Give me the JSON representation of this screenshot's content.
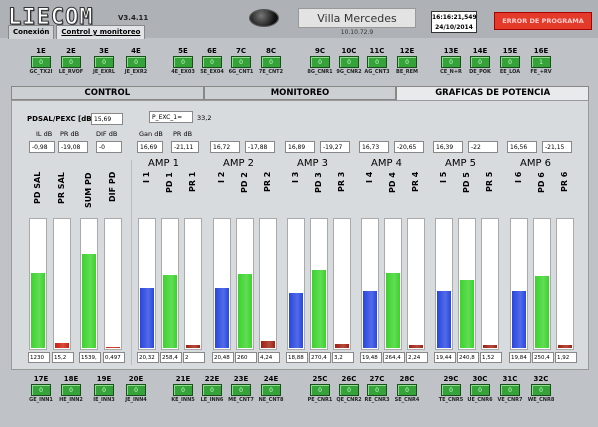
{
  "header": {
    "logo": "LIECOM",
    "version": "V3.4.11",
    "site_name": "Villa Mercedes",
    "ip": "10.10.72.9",
    "time": "16:16:21,549",
    "date": "24/10/2014",
    "alarm_label": "ERROR DE PROGRAMA",
    "tabs": [
      "Conexión",
      "Control y monitoreo"
    ]
  },
  "top_leds": [
    {
      "code": "1E",
      "val": "0",
      "label": "GC_TX2I"
    },
    {
      "code": "2E",
      "val": "0",
      "label": "LE_RVOF"
    },
    {
      "code": "3E",
      "val": "0",
      "label": "JE_EXRL"
    },
    {
      "code": "4E",
      "val": "0",
      "label": "JE_EXR2"
    },
    {
      "code": "5E",
      "val": "0",
      "label": "4E_EX03"
    },
    {
      "code": "6E",
      "val": "0",
      "label": "5E_EX04"
    },
    {
      "code": "7C",
      "val": "0",
      "label": "6G_CNT1"
    },
    {
      "code": "8C",
      "val": "0",
      "label": "7E_CNT2"
    },
    {
      "code": "9C",
      "val": "0",
      "label": "8G_CNR1"
    },
    {
      "code": "10C",
      "val": "0",
      "label": "9G_CNR2"
    },
    {
      "code": "11C",
      "val": "0",
      "label": "AG_CNT3"
    },
    {
      "code": "12E",
      "val": "0",
      "label": "BE_REM"
    },
    {
      "code": "13E",
      "val": "0",
      "label": "CE_N+R"
    },
    {
      "code": "14E",
      "val": "0",
      "label": "DE_POK"
    },
    {
      "code": "15E",
      "val": "0",
      "label": "EE_LOA"
    },
    {
      "code": "16E",
      "val": "1",
      "label": "FE_+RV"
    }
  ],
  "bottom_leds": [
    {
      "code": "17E",
      "val": "0",
      "label": "GE_INN1"
    },
    {
      "code": "18E",
      "val": "0",
      "label": "HE_INN2"
    },
    {
      "code": "19E",
      "val": "0",
      "label": "IE_INN3"
    },
    {
      "code": "20E",
      "val": "0",
      "label": "JE_INN4"
    },
    {
      "code": "21E",
      "val": "0",
      "label": "KE_INN5"
    },
    {
      "code": "22E",
      "val": "0",
      "label": "LE_INN6"
    },
    {
      "code": "23E",
      "val": "0",
      "label": "ME_CNT7"
    },
    {
      "code": "24E",
      "val": "0",
      "label": "NE_CNT8"
    },
    {
      "code": "25C",
      "val": "0",
      "label": "PE_CNR1"
    },
    {
      "code": "26C",
      "val": "0",
      "label": "QE_CNR2"
    },
    {
      "code": "27C",
      "val": "0",
      "label": "RE_CNR3"
    },
    {
      "code": "28C",
      "val": "0",
      "label": "SE_CNR4"
    },
    {
      "code": "29C",
      "val": "0",
      "label": "TE_CNR5"
    },
    {
      "code": "30C",
      "val": "0",
      "label": "UE_CNR6"
    },
    {
      "code": "31C",
      "val": "0",
      "label": "VE_CNR7"
    },
    {
      "code": "32C",
      "val": "0",
      "label": "WE_CNR8"
    }
  ],
  "main_tabs": [
    "CONTROL",
    "MONITOREO",
    "GRAFICAS DE POTENCIA"
  ],
  "summary": {
    "pdsal_label": "PDSAL/PEXC [dB]",
    "pdsal_value": "15,69",
    "pexc_label": "P_EXC_1=",
    "pexc_value": "33,2",
    "il_label": "IL dB",
    "il_value": "-0,98",
    "pr_label": "PR dB",
    "pr_value": "-19,08",
    "dif_label": "DIF dB",
    "dif_value": "-0",
    "gan_label": "Gan dB",
    "gan_value": "16,69",
    "pr2_label": "PR dB",
    "pr2_value": "-21,11"
  },
  "amp_gains": [
    {
      "gan": "16,72",
      "pr": "-17,88"
    },
    {
      "gan": "16,89",
      "pr": "-19,27"
    },
    {
      "gan": "16,73",
      "pr": "-20,65"
    },
    {
      "gan": "16,39",
      "pr": "-22"
    },
    {
      "gan": "16,56",
      "pr": "-21,15"
    }
  ],
  "left_bars": [
    {
      "label": "PD SAL",
      "value": "1230",
      "level": 0.58,
      "color": "#3bd32b"
    },
    {
      "label": "PR SAL",
      "value": "15,2",
      "level": 0.04,
      "color": "#cc2010"
    },
    {
      "label": "SUM PD",
      "value": "1539,",
      "level": 0.72,
      "color": "#3bd32b"
    },
    {
      "label": "DIF PD",
      "value": "0,497",
      "level": 0.01,
      "color": "#cc2010"
    }
  ],
  "amps": [
    {
      "title": "AMP 1",
      "bars": [
        {
          "label": "I 1",
          "value": "20,32",
          "level": 0.46,
          "color": "#2746e0"
        },
        {
          "label": "PD 1",
          "value": "258,4",
          "level": 0.56,
          "color": "#3bd32b"
        },
        {
          "label": "PR 1",
          "value": "2",
          "level": 0.02,
          "color": "#a02010"
        }
      ]
    },
    {
      "title": "AMP 2",
      "bars": [
        {
          "label": "I 2",
          "value": "20,48",
          "level": 0.46,
          "color": "#2746e0"
        },
        {
          "label": "PD 2",
          "value": "260",
          "level": 0.57,
          "color": "#3bd32b"
        },
        {
          "label": "PR 2",
          "value": "4,24",
          "level": 0.05,
          "color": "#a02010"
        }
      ]
    },
    {
      "title": "AMP 3",
      "bars": [
        {
          "label": "I 3",
          "value": "18,88",
          "level": 0.42,
          "color": "#2746e0"
        },
        {
          "label": "PD 3",
          "value": "270,4",
          "level": 0.6,
          "color": "#3bd32b"
        },
        {
          "label": "PR 3",
          "value": "3,2",
          "level": 0.03,
          "color": "#a02010"
        }
      ]
    },
    {
      "title": "AMP 4",
      "bars": [
        {
          "label": "I 4",
          "value": "19,48",
          "level": 0.44,
          "color": "#2746e0"
        },
        {
          "label": "PD 4",
          "value": "264,4",
          "level": 0.58,
          "color": "#3bd32b"
        },
        {
          "label": "PR 4",
          "value": "2,24",
          "level": 0.02,
          "color": "#a02010"
        }
      ]
    },
    {
      "title": "AMP 5",
      "bars": [
        {
          "label": "I 5",
          "value": "19,44",
          "level": 0.44,
          "color": "#2746e0"
        },
        {
          "label": "PD 5",
          "value": "240,8",
          "level": 0.52,
          "color": "#3bd32b"
        },
        {
          "label": "PR 5",
          "value": "1,52",
          "level": 0.02,
          "color": "#a02010"
        }
      ]
    },
    {
      "title": "AMP 6",
      "bars": [
        {
          "label": "I 6",
          "value": "19,84",
          "level": 0.44,
          "color": "#2746e0"
        },
        {
          "label": "PD 6",
          "value": "250,4",
          "level": 0.55,
          "color": "#3bd32b"
        },
        {
          "label": "PR 6",
          "value": "1,92",
          "level": 0.02,
          "color": "#a02010"
        }
      ]
    }
  ]
}
